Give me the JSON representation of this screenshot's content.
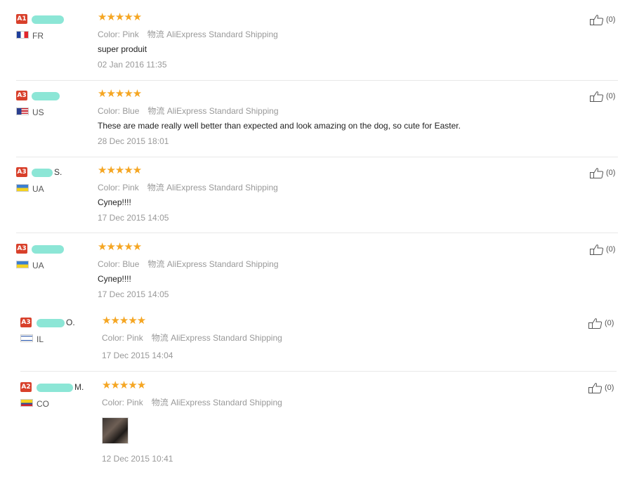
{
  "reviews": [
    {
      "level": "A1",
      "name": "",
      "country": "FR",
      "flag": "fr",
      "rating": 5,
      "color_label": "Color:",
      "color": "Pink",
      "shipping_label": "物流",
      "shipping": "AliExpress Standard Shipping",
      "text": "super produit",
      "date": "02 Jan 2016 11:35",
      "likes": "(0)"
    },
    {
      "level": "A3",
      "name": "",
      "country": "US",
      "flag": "us",
      "rating": 5,
      "color_label": "Color:",
      "color": "Blue",
      "shipping_label": "物流",
      "shipping": "AliExpress Standard Shipping",
      "text": "These are made really well better than expected and look amazing on the dog, so cute for Easter.",
      "date": "28 Dec 2015 18:01",
      "likes": "(0)"
    },
    {
      "level": "A3",
      "name": "S.",
      "country": "UA",
      "flag": "ua",
      "rating": 5,
      "color_label": "Color:",
      "color": "Pink",
      "shipping_label": "物流",
      "shipping": "AliExpress Standard Shipping",
      "text": "Супер!!!!",
      "date": "17 Dec 2015 14:05",
      "likes": "(0)"
    },
    {
      "level": "A3",
      "name": "",
      "country": "UA",
      "flag": "ua",
      "rating": 5,
      "color_label": "Color:",
      "color": "Blue",
      "shipping_label": "物流",
      "shipping": "AliExpress Standard Shipping",
      "text": "Супер!!!!",
      "date": "17 Dec 2015 14:05",
      "likes": "(0)"
    },
    {
      "level": "A3",
      "name": "O.",
      "country": "IL",
      "flag": "il",
      "rating": 5,
      "color_label": "Color:",
      "color": "Pink",
      "shipping_label": "物流",
      "shipping": "AliExpress Standard Shipping",
      "text": "",
      "date": "17 Dec 2015 14:04",
      "likes": "(0)"
    },
    {
      "level": "A2",
      "name": "M.",
      "country": "CO",
      "flag": "co",
      "rating": 5,
      "color_label": "Color:",
      "color": "Pink",
      "shipping_label": "物流",
      "shipping": "AliExpress Standard Shipping",
      "text": "",
      "date": "12 Dec 2015 10:41",
      "likes": "(0)",
      "has_photo": true
    }
  ],
  "stars": "★★★★★",
  "colors": {
    "badge": "#d8402b",
    "star": "#f5a623",
    "muted": "#999999"
  }
}
